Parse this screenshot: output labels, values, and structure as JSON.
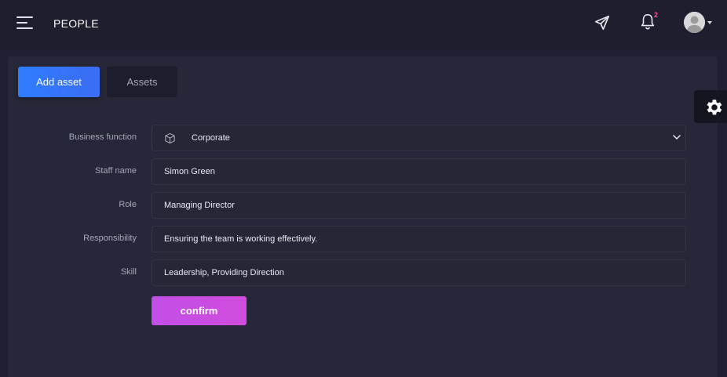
{
  "header": {
    "title": "PEOPLE",
    "notification_count": "2",
    "icons": [
      "menu-icon",
      "send-icon",
      "bell-icon",
      "avatar-icon"
    ]
  },
  "tabs": {
    "add_label": "Add asset",
    "assets_label": "Assets"
  },
  "form": {
    "business_function": {
      "label": "Business function",
      "value": "Corporate"
    },
    "staff_name": {
      "label": "Staff name",
      "value": "Simon Green"
    },
    "role": {
      "label": "Role",
      "value": "Managing Director"
    },
    "responsibility": {
      "label": "Responsibility",
      "value": "Ensuring the team is working effectively."
    },
    "skill": {
      "label": "Skill",
      "value": "Leadership, Providing Direction"
    },
    "confirm_label": "confirm"
  },
  "colors": {
    "background": "#1e1f30",
    "card": "#262839",
    "primary": "#2f7cff",
    "confirm": "#c84ee2",
    "badge": "#ff4f9a"
  }
}
